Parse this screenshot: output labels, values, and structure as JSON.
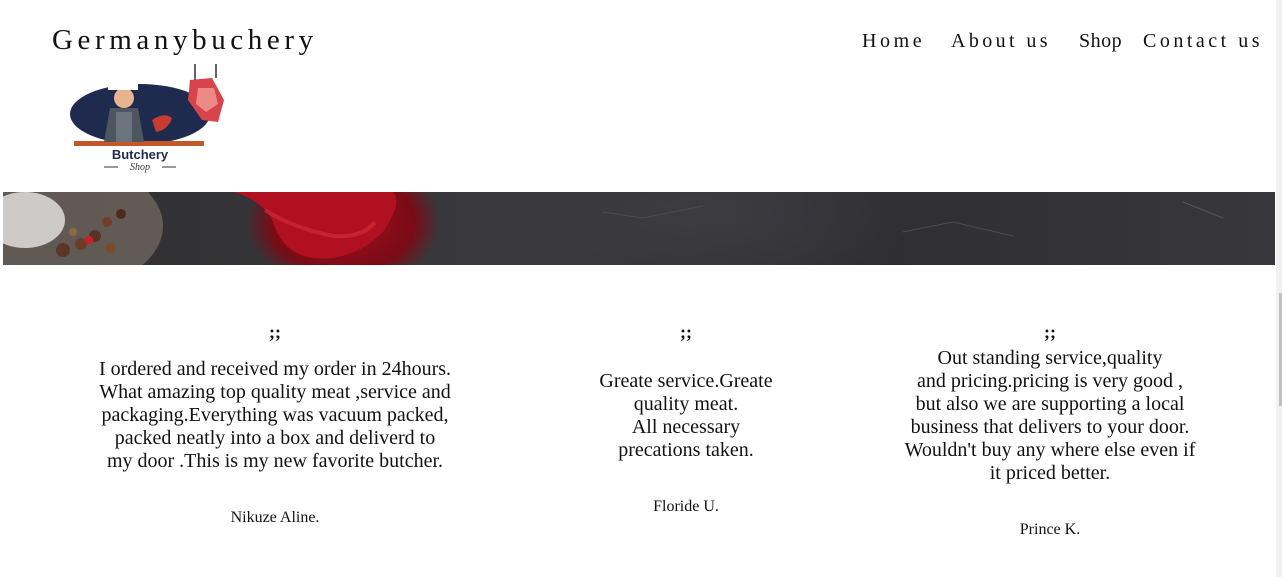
{
  "header": {
    "site_title": "Germanybuchery",
    "nav": [
      "Home",
      "About us",
      "Shop",
      "Contact us"
    ]
  },
  "logo": {
    "text": "Butchery",
    "subtext": "Shop"
  },
  "testimonials": [
    {
      "quote_mark": ";;",
      "lines": [
        "I ordered and received my order in 24hours.",
        "What amazing top quality meat ,service and",
        "packaging.Everything was vacuum packed,",
        "packed neatly into a box and deliverd to",
        "my door .This is my new favorite butcher."
      ],
      "author": "Nikuze Aline."
    },
    {
      "quote_mark": ";;",
      "lines": [
        "Greate service.Greate",
        "quality meat.",
        "All necessary",
        "precations taken."
      ],
      "author": "Floride U."
    },
    {
      "quote_mark": ";;",
      "lines": [
        "Out standing service,quality",
        "and pricing.pricing is very good ,",
        "but also we are supporting a local",
        "business that delivers to your door.",
        "Wouldn't buy any where else even if",
        "it priced better."
      ],
      "author": "Prince K."
    }
  ],
  "colors": {
    "text": "#111111",
    "banner_dark": "#2e2e31",
    "meat_red": "#a10e1c",
    "logo_navy": "#1f2a4f"
  }
}
